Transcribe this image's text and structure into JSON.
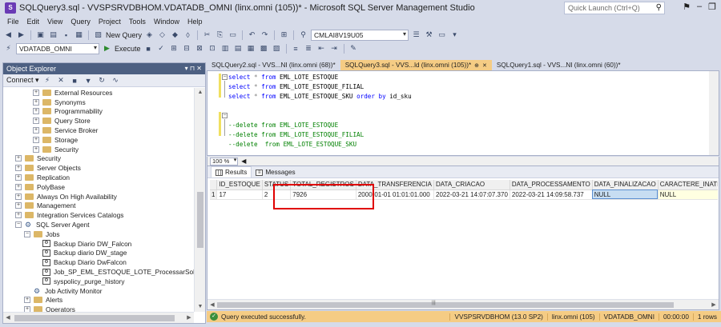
{
  "window": {
    "title": "SQLQuery3.sql - VVSPSRVDBHOM.VDATADB_OMNI (linx.omni (105))* - Microsoft SQL Server Management Studio",
    "quick_launch_placeholder": "Quick Launch (Ctrl+Q)"
  },
  "menu": [
    "File",
    "Edit",
    "View",
    "Query",
    "Project",
    "Tools",
    "Window",
    "Help"
  ],
  "toolbar": {
    "new_query": "New Query",
    "server_combo": "CMLAI8V19U05",
    "database_combo": "VDATADB_OMNI",
    "execute": "Execute"
  },
  "object_explorer": {
    "title": "Object Explorer",
    "header_buttons": "▾ ⊓ ✕",
    "connect": "Connect ▾",
    "tree": [
      {
        "label": "External Resources",
        "depth": 3,
        "exp": "+",
        "icon": "folder"
      },
      {
        "label": "Synonyms",
        "depth": 3,
        "exp": "+",
        "icon": "folder"
      },
      {
        "label": "Programmability",
        "depth": 3,
        "exp": "+",
        "icon": "folder"
      },
      {
        "label": "Query Store",
        "depth": 3,
        "exp": "+",
        "icon": "folder"
      },
      {
        "label": "Service Broker",
        "depth": 3,
        "exp": "+",
        "icon": "folder"
      },
      {
        "label": "Storage",
        "depth": 3,
        "exp": "+",
        "icon": "folder"
      },
      {
        "label": "Security",
        "depth": 3,
        "exp": "+",
        "icon": "folder"
      },
      {
        "label": "Security",
        "depth": 1,
        "exp": "+",
        "icon": "folder"
      },
      {
        "label": "Server Objects",
        "depth": 1,
        "exp": "+",
        "icon": "folder"
      },
      {
        "label": "Replication",
        "depth": 1,
        "exp": "+",
        "icon": "folder"
      },
      {
        "label": "PolyBase",
        "depth": 1,
        "exp": "+",
        "icon": "folder"
      },
      {
        "label": "Always On High Availability",
        "depth": 1,
        "exp": "+",
        "icon": "folder"
      },
      {
        "label": "Management",
        "depth": 1,
        "exp": "+",
        "icon": "folder"
      },
      {
        "label": "Integration Services Catalogs",
        "depth": 1,
        "exp": "+",
        "icon": "folder"
      },
      {
        "label": "SQL Server Agent",
        "depth": 1,
        "exp": "−",
        "icon": "agent"
      },
      {
        "label": "Jobs",
        "depth": 2,
        "exp": "−",
        "icon": "folder"
      },
      {
        "label": "Backup Diario DW_Falcon",
        "depth": 3,
        "exp": "",
        "icon": "job"
      },
      {
        "label": "Backup diario DW_stage",
        "depth": 3,
        "exp": "",
        "icon": "job"
      },
      {
        "label": "Backup Diario DwFalcon",
        "depth": 3,
        "exp": "",
        "icon": "job"
      },
      {
        "label": "Job_SP_EML_ESTOQUE_LOTE_ProcessarSolicitacao",
        "depth": 3,
        "exp": "",
        "icon": "job"
      },
      {
        "label": "syspolicy_purge_history",
        "depth": 3,
        "exp": "",
        "icon": "job"
      },
      {
        "label": "Job Activity Monitor",
        "depth": 2,
        "exp": "",
        "icon": "agent"
      },
      {
        "label": "Alerts",
        "depth": 2,
        "exp": "+",
        "icon": "folder"
      },
      {
        "label": "Operators",
        "depth": 2,
        "exp": "+",
        "icon": "folder"
      }
    ]
  },
  "tabs": [
    {
      "label": "SQLQuery2.sql - VVS...NI (linx.omni (68))*",
      "active": false
    },
    {
      "label": "SQLQuery3.sql - VVS...ld (linx.omni (105))*",
      "active": true
    },
    {
      "label": "SQLQuery1.sql - VVS...NI (linx.omni (60))*",
      "active": false
    }
  ],
  "editor": {
    "lines": [
      {
        "kind": "select",
        "text": "select * from EML_LOTE_ESTOQUE"
      },
      {
        "kind": "select",
        "text": "select * from EML_LOTE_ESTOQUE_FILIAL"
      },
      {
        "kind": "select",
        "text": "select * from EML_LOTE_ESTOQUE_SKU order by id_sku"
      },
      {
        "kind": "blank",
        "text": ""
      },
      {
        "kind": "blank",
        "text": ""
      },
      {
        "kind": "comment",
        "text": "--delete from EML_LOTE_ESTOQUE"
      },
      {
        "kind": "comment",
        "text": "--delete from EML_LOTE_ESTOQUE_FILIAL"
      },
      {
        "kind": "comment",
        "text": "--delete  from EML_LOTE_ESTOQUE_SKU"
      }
    ],
    "zoom": "100 %"
  },
  "results": {
    "tab_results": "Results",
    "tab_messages": "Messages",
    "columns": [
      "",
      "ID_ESTOQUE",
      "STATUS",
      "TOTAL_REGISTROS",
      "DATA_TRANSFERENCIA",
      "DATA_CRIACAO",
      "DATA_PROCESSAMENTO",
      "DATA_FINALIZACAO",
      "CARACTERE_INATIV"
    ],
    "rows": [
      [
        "1",
        "17",
        "2",
        "7926",
        "2000-01-01 01:01:01.000",
        "2022-03-21 14:07:07.370",
        "2022-03-21 14:09:58.737",
        "NULL",
        "NULL"
      ]
    ]
  },
  "status": {
    "message": "Query executed successfully.",
    "server": "VVSPSRVDBHOM (13.0 SP2)",
    "user": "linx.omni (105)",
    "database": "VDATADB_OMNI",
    "elapsed": "00:00:00",
    "rows": "1 rows"
  },
  "colors": {
    "accent_tab": "#f5cc84",
    "highlight_box": "#e00000"
  }
}
